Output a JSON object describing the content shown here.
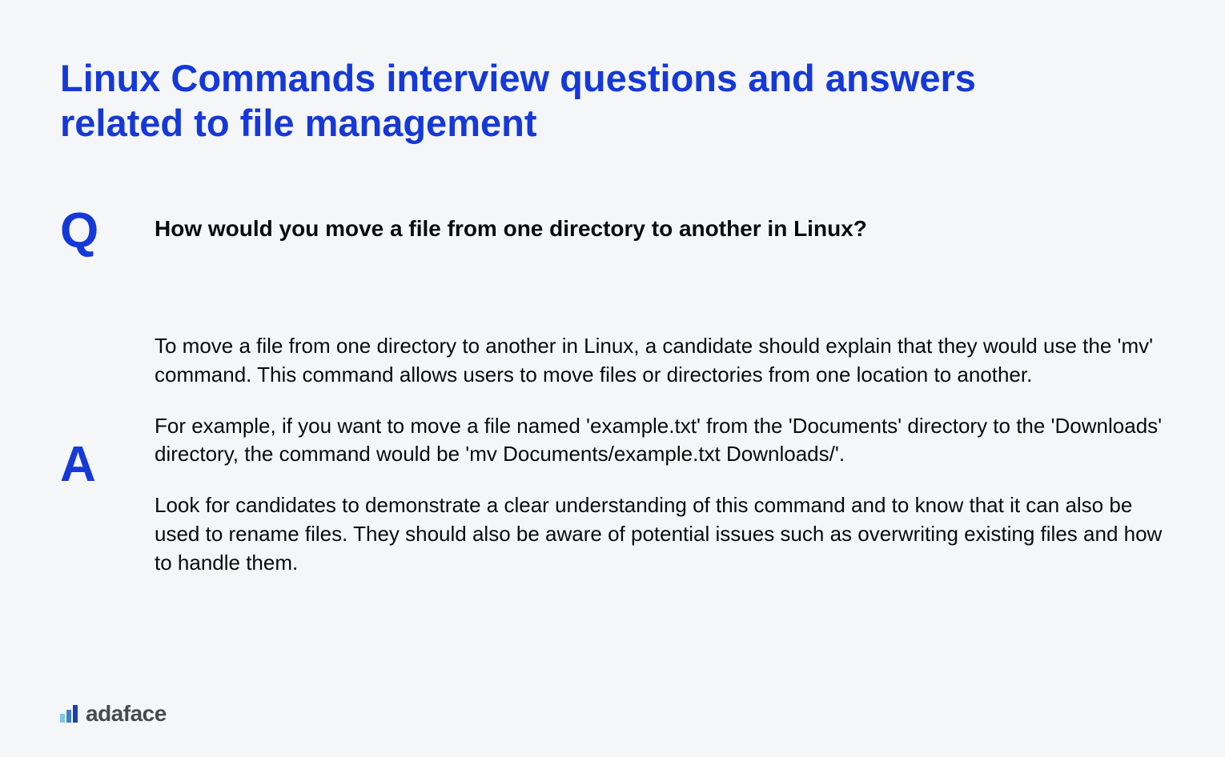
{
  "title": "Linux Commands interview questions and answers related to file management",
  "qLabel": "Q",
  "aLabel": "A",
  "question": "How would you move a file from one directory to another in Linux?",
  "answer": {
    "p1": "To move a file from one directory to another in Linux, a candidate should explain that they would use the 'mv' command. This command allows users to move files or directories from one location to another.",
    "p2": "For example, if you want to move a file named 'example.txt' from the 'Documents' directory to the 'Downloads' directory, the command would be 'mv Documents/example.txt Downloads/'.",
    "p3": "Look for candidates to demonstrate a clear understanding of this command and to know that it can also be used to rename files. They should also be aware of potential issues such as overwriting existing files and how to handle them."
  },
  "brand": "adaface"
}
